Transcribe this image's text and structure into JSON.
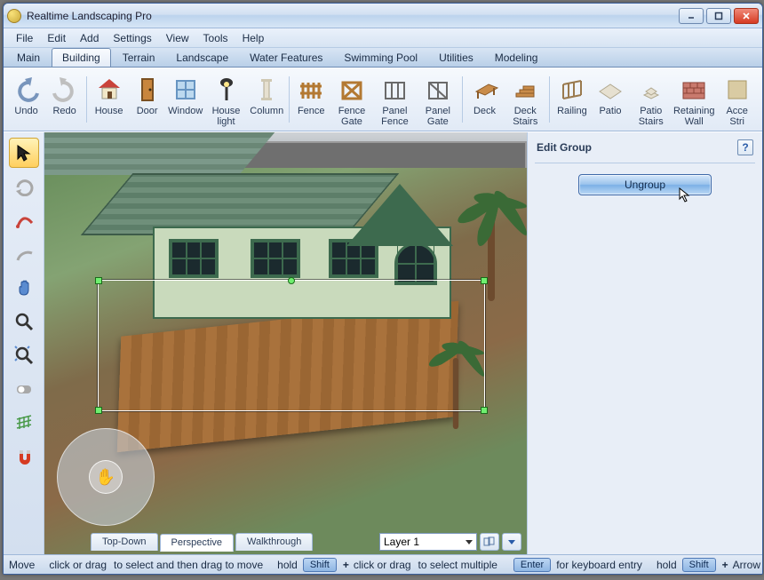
{
  "window": {
    "title": "Realtime Landscaping Pro"
  },
  "menu": {
    "items": [
      "File",
      "Edit",
      "Add",
      "Settings",
      "View",
      "Tools",
      "Help"
    ]
  },
  "tabs": {
    "items": [
      "Main",
      "Building",
      "Terrain",
      "Landscape",
      "Water Features",
      "Swimming Pool",
      "Utilities",
      "Modeling"
    ],
    "active_index": 1
  },
  "ribbon": {
    "grp1": [
      {
        "label": "Undo",
        "icon": "undo"
      },
      {
        "label": "Redo",
        "icon": "redo"
      }
    ],
    "grp2": [
      {
        "label": "House",
        "icon": "house"
      },
      {
        "label": "Door",
        "icon": "door"
      },
      {
        "label": "Window",
        "icon": "window"
      },
      {
        "label": "House\nlight",
        "icon": "lamp"
      },
      {
        "label": "Column",
        "icon": "column"
      }
    ],
    "grp3": [
      {
        "label": "Fence",
        "icon": "fence"
      },
      {
        "label": "Fence\nGate",
        "icon": "fgate"
      },
      {
        "label": "Panel\nFence",
        "icon": "pfence"
      },
      {
        "label": "Panel\nGate",
        "icon": "pgate"
      }
    ],
    "grp4": [
      {
        "label": "Deck",
        "icon": "deck"
      },
      {
        "label": "Deck\nStairs",
        "icon": "dstairs"
      }
    ],
    "grp5": [
      {
        "label": "Railing",
        "icon": "rail"
      },
      {
        "label": "Patio",
        "icon": "patio"
      },
      {
        "label": "Patio\nStairs",
        "icon": "pstairs"
      },
      {
        "label": "Retaining\nWall",
        "icon": "rwall"
      },
      {
        "label": "Acce\nStri",
        "icon": "acc"
      }
    ]
  },
  "lefttools": {
    "items": [
      {
        "name": "select-tool",
        "sel": true
      },
      {
        "name": "orbit-tool",
        "sel": false
      },
      {
        "name": "curve-tool",
        "sel": false
      },
      {
        "name": "arc-tool",
        "sel": false
      },
      {
        "name": "pan-tool",
        "sel": false
      },
      {
        "name": "zoom-tool",
        "sel": false
      },
      {
        "name": "zoom-extents-tool",
        "sel": false
      },
      {
        "name": "toggle-tool",
        "sel": false
      },
      {
        "name": "grid-tool",
        "sel": false
      },
      {
        "name": "magnet-tool",
        "sel": false
      }
    ]
  },
  "viewtabs": {
    "items": [
      "Top-Down",
      "Perspective",
      "Walkthrough"
    ],
    "active_index": 1
  },
  "layer": {
    "selected": "Layer 1"
  },
  "rightpanel": {
    "title": "Edit Group",
    "button": "Ungroup"
  },
  "status": {
    "mode": "Move",
    "hint1a": "click or drag",
    "hint1b": "to select and then drag to move",
    "hint2a": "hold",
    "hint2b": "click or drag",
    "hint2c": "to select multiple",
    "key_shift": "Shift",
    "key_enter": "Enter",
    "hint3": "for keyboard entry",
    "hint4a": "hold",
    "hint4b": "Arrow key to nudge"
  }
}
